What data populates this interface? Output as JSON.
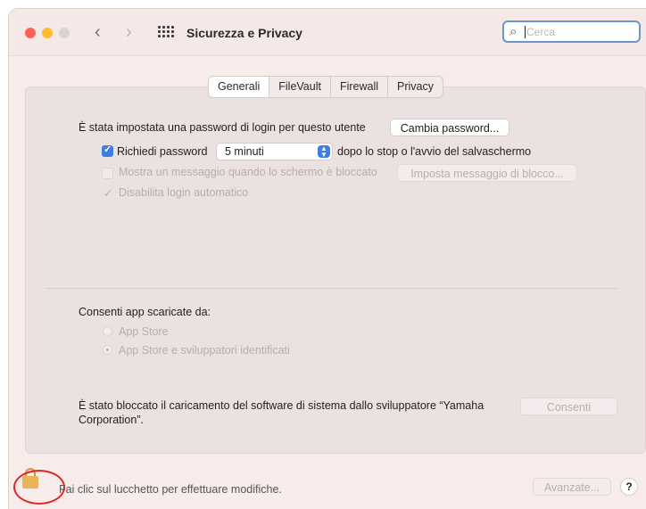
{
  "window": {
    "title": "Sicurezza e Privacy"
  },
  "search": {
    "placeholder": "Cerca"
  },
  "tabs": [
    "Generali",
    "FileVault",
    "Firewall",
    "Privacy"
  ],
  "general": {
    "login_password_text": "È stata impostata una password di login per questo utente",
    "change_password_button": "Cambia password...",
    "require_password_label": "Richiedi password",
    "require_password_checked": true,
    "require_password_value": "5 minuti",
    "require_password_suffix": "dopo lo stop o l'avvio del salvaschermo",
    "show_message_label": "Mostra un messaggio quando lo schermo è bloccato",
    "set_message_button": "Imposta messaggio di blocco...",
    "disable_autologin_label": "Disabilita login automatico",
    "allow_apps_label": "Consenti app scaricate da:",
    "radio_options": [
      "App Store",
      "App Store e sviluppatori identificati"
    ],
    "blocked_text_line1": "È stato bloccato il caricamento del software di sistema dallo sviluppatore “Yamaha",
    "blocked_text_line2": "Corporation”.",
    "allow_button": "Consenti"
  },
  "footer": {
    "lock_text": "Fai clic sul lucchetto per effettuare modifiche.",
    "advanced_button": "Avanzate...",
    "help_button": "?"
  },
  "colors": {
    "accent": "#3d7ee0",
    "annotation_circle": "#e0262a"
  }
}
